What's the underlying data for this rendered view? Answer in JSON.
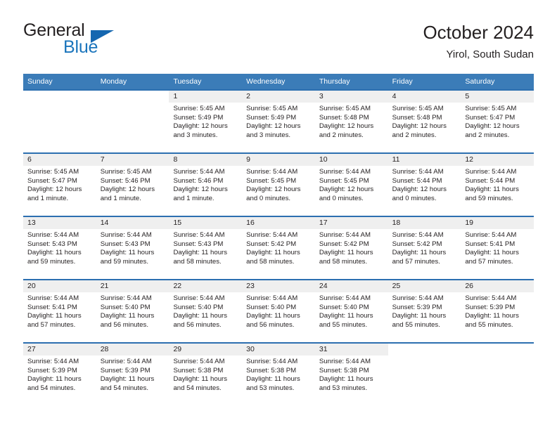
{
  "brand": {
    "name_top": "General",
    "name_bottom": "Blue",
    "triangle_color": "#1567b0",
    "bottom_color": "#1b75bc"
  },
  "header": {
    "title": "October 2024",
    "subtitle": "Yirol, South Sudan"
  },
  "theme": {
    "header_blue": "#3b7cb8",
    "row_rule_blue": "#2c6fb0",
    "daynum_band": "#efefef",
    "text": "#231f20"
  },
  "calendar": {
    "weekday_headers": [
      "Sunday",
      "Monday",
      "Tuesday",
      "Wednesday",
      "Thursday",
      "Friday",
      "Saturday"
    ],
    "weeks": [
      [
        {
          "day": "",
          "sunrise": "",
          "sunset": "",
          "daylight_1": "",
          "daylight_2": ""
        },
        {
          "day": "",
          "sunrise": "",
          "sunset": "",
          "daylight_1": "",
          "daylight_2": ""
        },
        {
          "day": "1",
          "sunrise": "Sunrise: 5:45 AM",
          "sunset": "Sunset: 5:49 PM",
          "daylight_1": "Daylight: 12 hours",
          "daylight_2": "and 3 minutes."
        },
        {
          "day": "2",
          "sunrise": "Sunrise: 5:45 AM",
          "sunset": "Sunset: 5:49 PM",
          "daylight_1": "Daylight: 12 hours",
          "daylight_2": "and 3 minutes."
        },
        {
          "day": "3",
          "sunrise": "Sunrise: 5:45 AM",
          "sunset": "Sunset: 5:48 PM",
          "daylight_1": "Daylight: 12 hours",
          "daylight_2": "and 2 minutes."
        },
        {
          "day": "4",
          "sunrise": "Sunrise: 5:45 AM",
          "sunset": "Sunset: 5:48 PM",
          "daylight_1": "Daylight: 12 hours",
          "daylight_2": "and 2 minutes."
        },
        {
          "day": "5",
          "sunrise": "Sunrise: 5:45 AM",
          "sunset": "Sunset: 5:47 PM",
          "daylight_1": "Daylight: 12 hours",
          "daylight_2": "and 2 minutes."
        }
      ],
      [
        {
          "day": "6",
          "sunrise": "Sunrise: 5:45 AM",
          "sunset": "Sunset: 5:47 PM",
          "daylight_1": "Daylight: 12 hours",
          "daylight_2": "and 1 minute."
        },
        {
          "day": "7",
          "sunrise": "Sunrise: 5:45 AM",
          "sunset": "Sunset: 5:46 PM",
          "daylight_1": "Daylight: 12 hours",
          "daylight_2": "and 1 minute."
        },
        {
          "day": "8",
          "sunrise": "Sunrise: 5:44 AM",
          "sunset": "Sunset: 5:46 PM",
          "daylight_1": "Daylight: 12 hours",
          "daylight_2": "and 1 minute."
        },
        {
          "day": "9",
          "sunrise": "Sunrise: 5:44 AM",
          "sunset": "Sunset: 5:45 PM",
          "daylight_1": "Daylight: 12 hours",
          "daylight_2": "and 0 minutes."
        },
        {
          "day": "10",
          "sunrise": "Sunrise: 5:44 AM",
          "sunset": "Sunset: 5:45 PM",
          "daylight_1": "Daylight: 12 hours",
          "daylight_2": "and 0 minutes."
        },
        {
          "day": "11",
          "sunrise": "Sunrise: 5:44 AM",
          "sunset": "Sunset: 5:44 PM",
          "daylight_1": "Daylight: 12 hours",
          "daylight_2": "and 0 minutes."
        },
        {
          "day": "12",
          "sunrise": "Sunrise: 5:44 AM",
          "sunset": "Sunset: 5:44 PM",
          "daylight_1": "Daylight: 11 hours",
          "daylight_2": "and 59 minutes."
        }
      ],
      [
        {
          "day": "13",
          "sunrise": "Sunrise: 5:44 AM",
          "sunset": "Sunset: 5:43 PM",
          "daylight_1": "Daylight: 11 hours",
          "daylight_2": "and 59 minutes."
        },
        {
          "day": "14",
          "sunrise": "Sunrise: 5:44 AM",
          "sunset": "Sunset: 5:43 PM",
          "daylight_1": "Daylight: 11 hours",
          "daylight_2": "and 59 minutes."
        },
        {
          "day": "15",
          "sunrise": "Sunrise: 5:44 AM",
          "sunset": "Sunset: 5:43 PM",
          "daylight_1": "Daylight: 11 hours",
          "daylight_2": "and 58 minutes."
        },
        {
          "day": "16",
          "sunrise": "Sunrise: 5:44 AM",
          "sunset": "Sunset: 5:42 PM",
          "daylight_1": "Daylight: 11 hours",
          "daylight_2": "and 58 minutes."
        },
        {
          "day": "17",
          "sunrise": "Sunrise: 5:44 AM",
          "sunset": "Sunset: 5:42 PM",
          "daylight_1": "Daylight: 11 hours",
          "daylight_2": "and 58 minutes."
        },
        {
          "day": "18",
          "sunrise": "Sunrise: 5:44 AM",
          "sunset": "Sunset: 5:42 PM",
          "daylight_1": "Daylight: 11 hours",
          "daylight_2": "and 57 minutes."
        },
        {
          "day": "19",
          "sunrise": "Sunrise: 5:44 AM",
          "sunset": "Sunset: 5:41 PM",
          "daylight_1": "Daylight: 11 hours",
          "daylight_2": "and 57 minutes."
        }
      ],
      [
        {
          "day": "20",
          "sunrise": "Sunrise: 5:44 AM",
          "sunset": "Sunset: 5:41 PM",
          "daylight_1": "Daylight: 11 hours",
          "daylight_2": "and 57 minutes."
        },
        {
          "day": "21",
          "sunrise": "Sunrise: 5:44 AM",
          "sunset": "Sunset: 5:40 PM",
          "daylight_1": "Daylight: 11 hours",
          "daylight_2": "and 56 minutes."
        },
        {
          "day": "22",
          "sunrise": "Sunrise: 5:44 AM",
          "sunset": "Sunset: 5:40 PM",
          "daylight_1": "Daylight: 11 hours",
          "daylight_2": "and 56 minutes."
        },
        {
          "day": "23",
          "sunrise": "Sunrise: 5:44 AM",
          "sunset": "Sunset: 5:40 PM",
          "daylight_1": "Daylight: 11 hours",
          "daylight_2": "and 56 minutes."
        },
        {
          "day": "24",
          "sunrise": "Sunrise: 5:44 AM",
          "sunset": "Sunset: 5:40 PM",
          "daylight_1": "Daylight: 11 hours",
          "daylight_2": "and 55 minutes."
        },
        {
          "day": "25",
          "sunrise": "Sunrise: 5:44 AM",
          "sunset": "Sunset: 5:39 PM",
          "daylight_1": "Daylight: 11 hours",
          "daylight_2": "and 55 minutes."
        },
        {
          "day": "26",
          "sunrise": "Sunrise: 5:44 AM",
          "sunset": "Sunset: 5:39 PM",
          "daylight_1": "Daylight: 11 hours",
          "daylight_2": "and 55 minutes."
        }
      ],
      [
        {
          "day": "27",
          "sunrise": "Sunrise: 5:44 AM",
          "sunset": "Sunset: 5:39 PM",
          "daylight_1": "Daylight: 11 hours",
          "daylight_2": "and 54 minutes."
        },
        {
          "day": "28",
          "sunrise": "Sunrise: 5:44 AM",
          "sunset": "Sunset: 5:39 PM",
          "daylight_1": "Daylight: 11 hours",
          "daylight_2": "and 54 minutes."
        },
        {
          "day": "29",
          "sunrise": "Sunrise: 5:44 AM",
          "sunset": "Sunset: 5:38 PM",
          "daylight_1": "Daylight: 11 hours",
          "daylight_2": "and 54 minutes."
        },
        {
          "day": "30",
          "sunrise": "Sunrise: 5:44 AM",
          "sunset": "Sunset: 5:38 PM",
          "daylight_1": "Daylight: 11 hours",
          "daylight_2": "and 53 minutes."
        },
        {
          "day": "31",
          "sunrise": "Sunrise: 5:44 AM",
          "sunset": "Sunset: 5:38 PM",
          "daylight_1": "Daylight: 11 hours",
          "daylight_2": "and 53 minutes."
        },
        {
          "day": "",
          "sunrise": "",
          "sunset": "",
          "daylight_1": "",
          "daylight_2": ""
        },
        {
          "day": "",
          "sunrise": "",
          "sunset": "",
          "daylight_1": "",
          "daylight_2": ""
        }
      ]
    ]
  }
}
